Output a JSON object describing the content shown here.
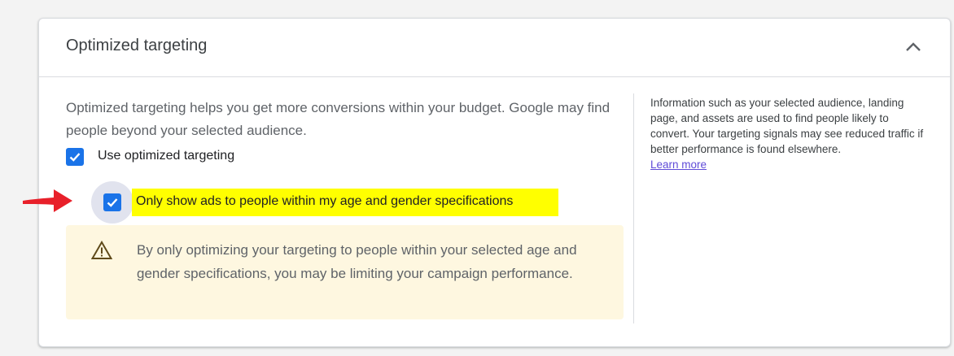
{
  "card": {
    "title": "Optimized targeting",
    "collapse_icon": "chevron-up-icon"
  },
  "description": "Optimized targeting helps you get more conversions within your budget. Google may find people beyond your selected audience.",
  "options": {
    "use_optimized": {
      "label": "Use optimized targeting",
      "checked": true
    },
    "age_gender_only": {
      "label": "Only show ads to people within my age and gender specifications",
      "checked": true,
      "highlighted": true
    }
  },
  "warning": {
    "icon": "warning-triangle-icon",
    "text": "By only optimizing your targeting to people within your selected age and gender specifications, you may be limiting your campaign performance."
  },
  "side_panel": {
    "info": "Information such as your selected audience, landing page, and assets are used to find people likely to convert. Your targeting signals may see reduced traffic if better performance is found elsewhere.",
    "learn_more": "Learn more"
  },
  "annotation": {
    "arrow_icon": "red-arrow-icon",
    "highlight_color": "#ffff00",
    "arrow_color": "#e8202a"
  },
  "colors": {
    "accent": "#1a73e8",
    "warning_bg": "#fef7e0",
    "link": "#5f4bd8"
  }
}
